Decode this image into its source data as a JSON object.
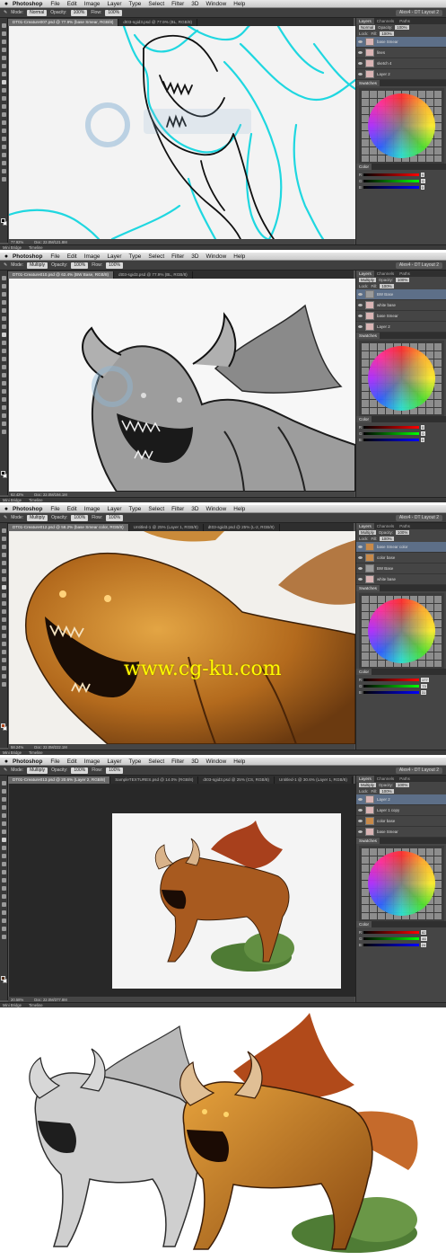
{
  "menubar": {
    "apple": "",
    "app_name": "Photoshop",
    "items": [
      "File",
      "Edit",
      "Image",
      "Layer",
      "Type",
      "Select",
      "Filter",
      "3D",
      "Window",
      "Help"
    ]
  },
  "shots": [
    {
      "mode": "Normal",
      "opacity": "100%",
      "flow": "100%",
      "workspace": "Alex4 - DT Layout 2",
      "tabs": [
        "DT01-Creature007.psd @ 77.9% (base Smear, RGB/8)",
        "dt03-sgid3.psd @ 77.9% (BL, RGB/8)"
      ],
      "zoom": "77.92%",
      "doc": "Doc: 22.0M/121.8M",
      "layers": [
        "base Smear",
        "lines",
        "sketch 4",
        "Layer 2"
      ],
      "rgb": [
        "0",
        "0",
        "0"
      ]
    },
    {
      "mode": "Multiply",
      "opacity": "100%",
      "flow": "100%",
      "workspace": "Alex4 - DT Layout 2",
      "tabs": [
        "DT01-Creature010.psd @ 62.4% (BW Base, RGB/8)",
        "dt03-sgid3.psd @ 77.9% (BL, RGB/8)"
      ],
      "zoom": "62.42%",
      "doc": "Doc: 22.0M/194.1M",
      "layers": [
        "BW Base",
        "white base",
        "base Smear",
        "Layer 2"
      ],
      "rgb": [
        "0",
        "0",
        "0"
      ]
    },
    {
      "mode": "Multiply",
      "opacity": "100%",
      "flow": "100%",
      "workspace": "Alex4 - DT Layout 2",
      "tabs": [
        "DT01-Creature012.psd @ 58.2% (base Smear color, RGB/8)",
        "Untitled-1 @ 25% (Layer 1, RGB/8)",
        "dt03-sgid3.psd @ 25% (L-2, RGB/8)"
      ],
      "zoom": "58.24%",
      "doc": "Doc: 22.0M/222.1M",
      "layers": [
        "base Smear color",
        "color base",
        "BW Base",
        "white base"
      ],
      "rgb": [
        "177",
        "73",
        "31"
      ]
    },
    {
      "mode": "Multiply",
      "opacity": "100%",
      "flow": "100%",
      "workspace": "Alex4 - DT Layout 2",
      "tabs": [
        "DT01-Creature013.psd @ 20.6% (Layer 2, RGB/8)",
        "SampleTEXTURES.psd @ 14.0% (RGB/8)",
        "dt03-sgid3.psd @ 25% (CS, RGB/8)",
        "Untitled-1 @ 30.6% (Layer 1, RGB/8)"
      ],
      "zoom": "20.58%",
      "doc": "Doc: 22.0M/377.8M",
      "layers": [
        "Layer 2",
        "Layer 1 copy",
        "color base",
        "base Smear"
      ],
      "rgb": [
        "82",
        "46",
        "24"
      ]
    }
  ],
  "panel_tabs": [
    "Layers",
    "Channels",
    "Paths"
  ],
  "layer_mode_label": "Normal",
  "opacity_label": "Opacity:",
  "fill_label": "Fill:",
  "lock_label": "Lock:",
  "swatches_label": "Swatches",
  "color_label": "Color",
  "opt_labels": {
    "mode": "Mode:",
    "opacity": "Opacity:",
    "flow": "Flow:"
  },
  "bridge": {
    "mini_bridge": "Mini Bridge",
    "timeline": "Timeline"
  },
  "watermark": {
    "text": "www.cg-ku.com"
  },
  "colors": {
    "chrome": "#535353",
    "panel": "#454545",
    "sketch_cyan": "#1fd7e0",
    "creature_orange": "#c07a23"
  }
}
